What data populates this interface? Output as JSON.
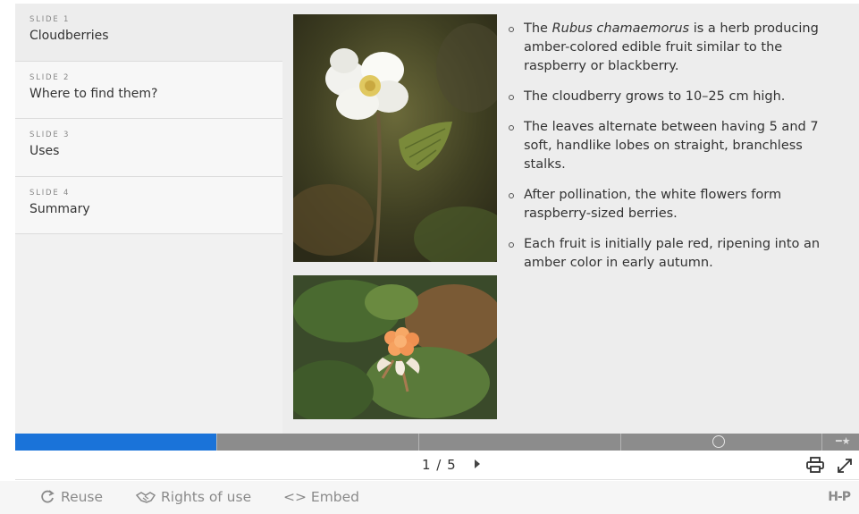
{
  "sidebar": {
    "items": [
      {
        "number": "SLIDE 1",
        "title": "Cloudberries"
      },
      {
        "number": "SLIDE 2",
        "title": "Where to find them?"
      },
      {
        "number": "SLIDE 3",
        "title": "Uses"
      },
      {
        "number": "SLIDE 4",
        "title": "Summary"
      }
    ]
  },
  "content": {
    "bullets": [
      {
        "pre": "The ",
        "italic": "Rubus chamaemorus",
        "post": " is a herb producing amber-colored edible fruit similar to the raspberry or blackberry."
      },
      {
        "pre": "The cloudberry grows to 10–25 cm high.",
        "italic": "",
        "post": ""
      },
      {
        "pre": "The leaves alternate between having 5 and 7 soft, handlike lobes on straight, branchless stalks.",
        "italic": "",
        "post": ""
      },
      {
        "pre": "After pollination, the white flowers form raspberry-sized berries.",
        "italic": "",
        "post": ""
      },
      {
        "pre": "Each fruit is initially pale red, ripening into an amber color in early autumn.",
        "italic": "",
        "post": ""
      }
    ]
  },
  "progress": {
    "current": 1,
    "total": 5,
    "fraction": 0.2
  },
  "nav": {
    "counter": "1 / 5"
  },
  "footer": {
    "reuse": "Reuse",
    "rights": "Rights of use",
    "embed": "<> Embed",
    "logo": "H-P"
  },
  "icons": {
    "reuse": "refresh-icon",
    "rights": "handshake-icon",
    "print": "print-icon",
    "expand": "expand-icon",
    "next": "next-arrow-icon"
  },
  "colors": {
    "progress_fill": "#1a73d9",
    "progress_track": "#8c8c8c"
  }
}
